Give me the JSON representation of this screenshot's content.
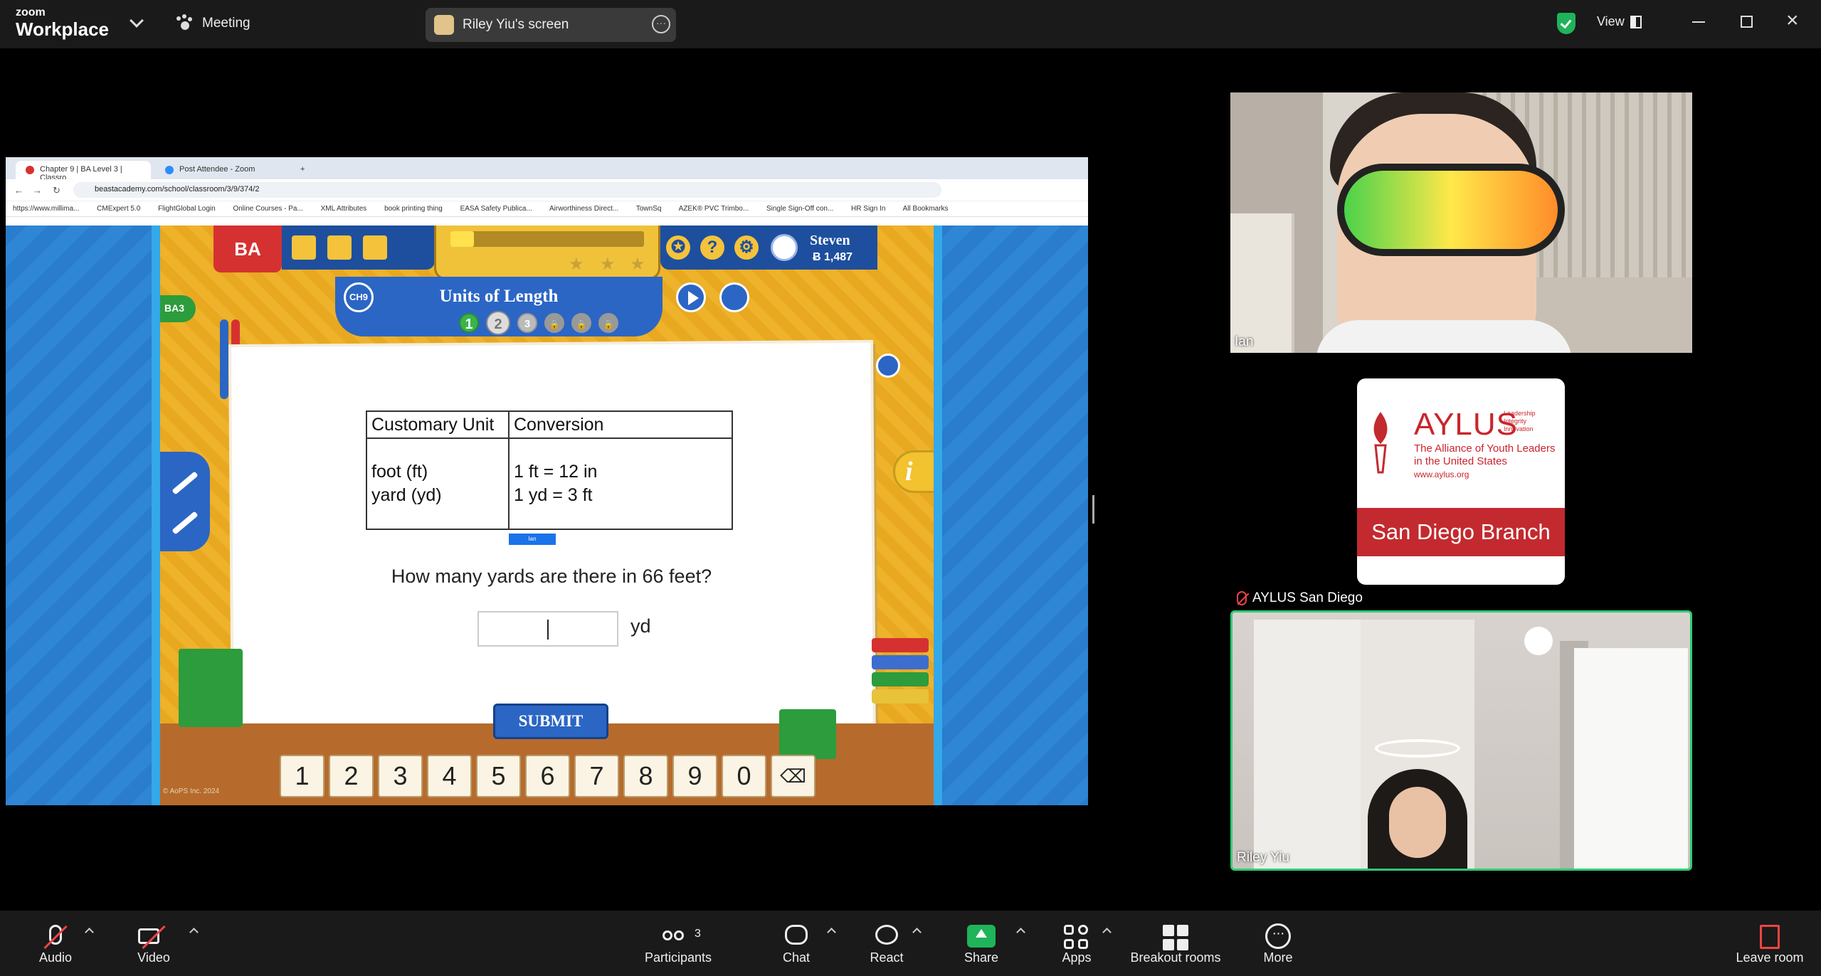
{
  "topbar": {
    "logo_small": "zoom",
    "logo_big": "Workplace",
    "meeting_label": "Meeting",
    "screen_share_label": "Riley Yiu's screen",
    "view_label": "View"
  },
  "browser": {
    "tabs": [
      {
        "label": "Chapter 9 | BA Level 3 | Classro..."
      },
      {
        "label": "Post Attendee - Zoom"
      }
    ],
    "url": "beastacademy.com/school/classroom/3/9/374/2",
    "bookmarks": [
      "https://www.millima...",
      "CMExpert 5.0",
      "FlightGlobal Login",
      "Online Courses - Pa...",
      "XML Attributes",
      "book printing thing",
      "EASA Safety Publica...",
      "Airworthiness Direct...",
      "TownSq",
      "AZEK® PVC Trimbo...",
      "Single Sign-Off con...",
      "HR Sign In",
      "All Bookmarks"
    ]
  },
  "game": {
    "logo": "BA",
    "user_name": "Steven",
    "user_points": "1,487",
    "chapter_badge": "BA3",
    "chapter_button": "CH9",
    "title": "Units of Length",
    "progress_fraction": 0.12,
    "steps": [
      {
        "label": "1",
        "state": "done"
      },
      {
        "label": "2",
        "state": "current"
      },
      {
        "label": "3",
        "state": "todo"
      },
      {
        "label": "",
        "state": "locked"
      },
      {
        "label": "",
        "state": "locked"
      },
      {
        "label": "",
        "state": "locked"
      }
    ],
    "info_icon": "i",
    "table": {
      "headers": [
        "Customary Unit",
        "Conversion"
      ],
      "units": [
        "foot (ft)",
        "yard (yd)"
      ],
      "conversions": [
        "1 ft = 12 in",
        "1 yd = 3 ft"
      ]
    },
    "annotation_tag": "Ian",
    "question": "How many yards are there in 66 feet?",
    "answer_value": "",
    "answer_unit": "yd",
    "submit_label": "SUBMIT",
    "keypad": [
      "1",
      "2",
      "3",
      "4",
      "5",
      "6",
      "7",
      "8",
      "9",
      "0"
    ],
    "backspace_icon": "backspace-icon",
    "copyright": "© AoPS Inc. 2024"
  },
  "participants": {
    "ian": {
      "name": "Ian"
    },
    "aylus": {
      "name": "AYLUS San Diego",
      "logo_title": "AYLUS",
      "logo_tagline": [
        "Leadership",
        "Integrity",
        "Innovation"
      ],
      "logo_subtitle": "The Alliance of Youth Leaders in the United States",
      "logo_url": "www.aylus.org",
      "branch": "San Diego Branch"
    },
    "riley": {
      "name": "Riley Yiu"
    }
  },
  "toolbar": {
    "audio": "Audio",
    "video": "Video",
    "participants": "Participants",
    "participants_count": "3",
    "chat": "Chat",
    "react": "React",
    "share": "Share",
    "apps": "Apps",
    "breakout": "Breakout rooms",
    "more": "More",
    "leave": "Leave room"
  },
  "colors": {
    "share_green": "#1fb35a",
    "speaker_border": "#2ecc71",
    "aylus_red": "#c22a2f",
    "ba_blue": "#2b66c4"
  }
}
